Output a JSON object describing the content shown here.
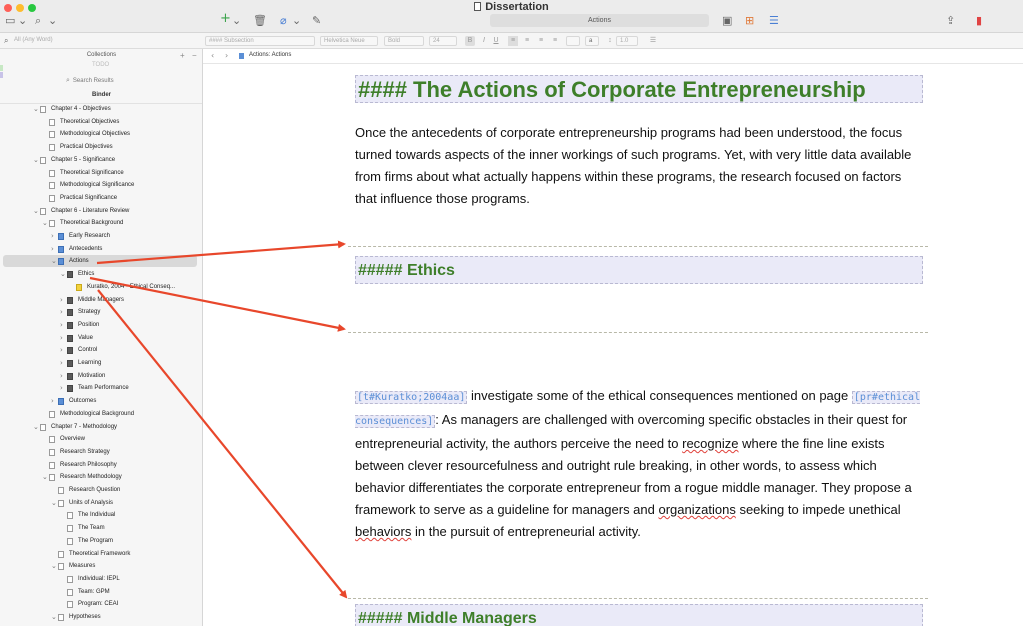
{
  "window": {
    "title": "Dissertation",
    "title_field": "Actions"
  },
  "formatbar": {
    "search_placeholder": "All (Any Word)",
    "style": "#### Subsection",
    "font": "Helvetica Neue",
    "weight": "Bold",
    "size": "24",
    "bold_btn": "B",
    "italic_btn": "I",
    "underline_btn": "U",
    "highlight_btn": "a",
    "line_spacing": "1.0"
  },
  "sidebar": {
    "collections": "Collections",
    "todo": "TODO",
    "search_results": "Search Results",
    "binder": "Binder",
    "rows": [
      {
        "label": "Chapter 4 - Objectives",
        "depth": 0,
        "icon": "doc",
        "chev": "down"
      },
      {
        "label": "Theoretical Objectives",
        "depth": 1,
        "icon": "doc"
      },
      {
        "label": "Methodological Objectives",
        "depth": 1,
        "icon": "doc"
      },
      {
        "label": "Practical Objectives",
        "depth": 1,
        "icon": "doc"
      },
      {
        "label": "Chapter 5 - Significance",
        "depth": 0,
        "icon": "doc",
        "chev": "down"
      },
      {
        "label": "Theoretical Significance",
        "depth": 1,
        "icon": "doc"
      },
      {
        "label": "Methodological Significance",
        "depth": 1,
        "icon": "doc"
      },
      {
        "label": "Practical Significance",
        "depth": 1,
        "icon": "doc"
      },
      {
        "label": "Chapter 6 - Literature Review",
        "depth": 0,
        "icon": "doc",
        "chev": "down"
      },
      {
        "label": "Theoretical Background",
        "depth": 1,
        "icon": "doc",
        "chev": "down"
      },
      {
        "label": "Early Research",
        "depth": 2,
        "icon": "blue",
        "chev": "right"
      },
      {
        "label": "Antecedents",
        "depth": 2,
        "icon": "blue",
        "chev": "right"
      },
      {
        "label": "Actions",
        "depth": 2,
        "icon": "blue",
        "chev": "down",
        "selected": true
      },
      {
        "label": "Ethics",
        "depth": 3,
        "icon": "grid",
        "chev": "down"
      },
      {
        "label": "Kuratko, 2004 - Ethical Conseq...",
        "depth": 4,
        "icon": "yellow"
      },
      {
        "label": "Middle Managers",
        "depth": 3,
        "icon": "grid",
        "chev": "right"
      },
      {
        "label": "Strategy",
        "depth": 3,
        "icon": "grid",
        "chev": "right"
      },
      {
        "label": "Position",
        "depth": 3,
        "icon": "grid",
        "chev": "right"
      },
      {
        "label": "Value",
        "depth": 3,
        "icon": "grid",
        "chev": "right"
      },
      {
        "label": "Control",
        "depth": 3,
        "icon": "grid",
        "chev": "right"
      },
      {
        "label": "Learning",
        "depth": 3,
        "icon": "grid",
        "chev": "right"
      },
      {
        "label": "Motivation",
        "depth": 3,
        "icon": "grid",
        "chev": "right"
      },
      {
        "label": "Team Performance",
        "depth": 3,
        "icon": "grid",
        "chev": "right"
      },
      {
        "label": "Outcomes",
        "depth": 2,
        "icon": "blue",
        "chev": "right"
      },
      {
        "label": "Methodological Background",
        "depth": 1,
        "icon": "doc"
      },
      {
        "label": "Chapter 7 - Methodology",
        "depth": 0,
        "icon": "doc",
        "chev": "down"
      },
      {
        "label": "Overview",
        "depth": 1,
        "icon": "doc"
      },
      {
        "label": "Research Strategy",
        "depth": 1,
        "icon": "doc"
      },
      {
        "label": "Research Philosophy",
        "depth": 1,
        "icon": "doc"
      },
      {
        "label": "Research Methodology",
        "depth": 1,
        "icon": "doc",
        "chev": "down"
      },
      {
        "label": "Research Question",
        "depth": 2,
        "icon": "doc"
      },
      {
        "label": "Units of Analysis",
        "depth": 2,
        "icon": "doc",
        "chev": "down"
      },
      {
        "label": "The Individual",
        "depth": 3,
        "icon": "doc"
      },
      {
        "label": "The Team",
        "depth": 3,
        "icon": "doc"
      },
      {
        "label": "The Program",
        "depth": 3,
        "icon": "doc"
      },
      {
        "label": "Theoretical Framework",
        "depth": 2,
        "icon": "doc"
      },
      {
        "label": "Measures",
        "depth": 2,
        "icon": "doc",
        "chev": "down"
      },
      {
        "label": "Individual: IEPL",
        "depth": 3,
        "icon": "doc"
      },
      {
        "label": "Team: GPM",
        "depth": 3,
        "icon": "doc"
      },
      {
        "label": "Program: CEAI",
        "depth": 3,
        "icon": "doc"
      },
      {
        "label": "Hypotheses",
        "depth": 2,
        "icon": "doc",
        "chev": "down"
      }
    ]
  },
  "pathbar": {
    "crumb": "Actions: Actions"
  },
  "editor": {
    "heading1": "#### The Actions of Corporate Entrepreneurship",
    "para1": "Once the antecedents of corporate entrepreneurship programs had been understood, the focus turned towards aspects of the inner workings of such programs. Yet, with very little data available from firms about what actually happens within these programs, the research focused on factors that influence those programs.",
    "heading2": "##### Ethics",
    "cite1": "[t#Kuratko;2004aa]",
    "para2_a": " investigate some of the ethical consequences mentioned on page ",
    "cite2": "[pr#ethical consequences]",
    "para2_b": ": As managers are challenged with overcoming specific obstacles in their quest for entrepreneurial activity, the authors perceive the need to ",
    "squig1": "recognize",
    "para2_c": " where the fine line exists between clever resourcefulness and outright rule breaking, in other words, to assess which behavior differentiates the corporate entrepreneur from a rogue middle manager. They propose a framework to serve as a guideline for managers and ",
    "squig2": "organizations",
    "para2_d": " seeking to impede unethical ",
    "squig3": "behaviors",
    "para2_e": " in the pursuit of entrepreneurial activity.",
    "heading3": "##### Middle Managers"
  },
  "colors": {
    "heading_green": "#3e7f2a",
    "heading_bg": "#eaeaf8",
    "annotation_arrow": "#e8472b",
    "selection": "#d9d9d9"
  }
}
